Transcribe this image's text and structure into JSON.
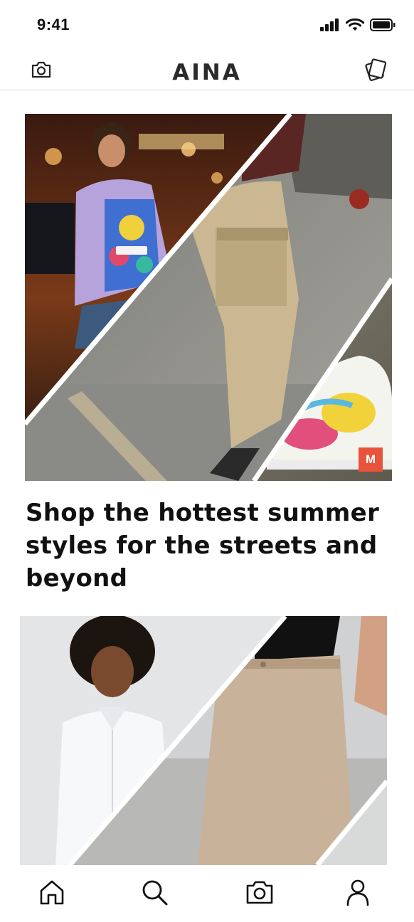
{
  "status_bar": {
    "time": "9:41"
  },
  "header": {
    "brand": "AINA",
    "left_icon": "camera-icon",
    "right_icon": "swap-cards-icon"
  },
  "feed": {
    "cards": [
      {
        "id": "street-collage",
        "badge": "M",
        "headline": "Shop the hottest summer styles for the streets and beyond"
      },
      {
        "id": "office-collage"
      }
    ]
  },
  "tab_bar": {
    "tabs": [
      {
        "name": "home",
        "icon": "home-icon",
        "active": true
      },
      {
        "name": "search",
        "icon": "search-icon"
      },
      {
        "name": "camera",
        "icon": "camera-icon"
      },
      {
        "name": "profile",
        "icon": "user-icon"
      }
    ]
  },
  "colors": {
    "badge": "#e8533b",
    "brand_text": "#2b2b2b",
    "divider": "#d6d6d6"
  }
}
